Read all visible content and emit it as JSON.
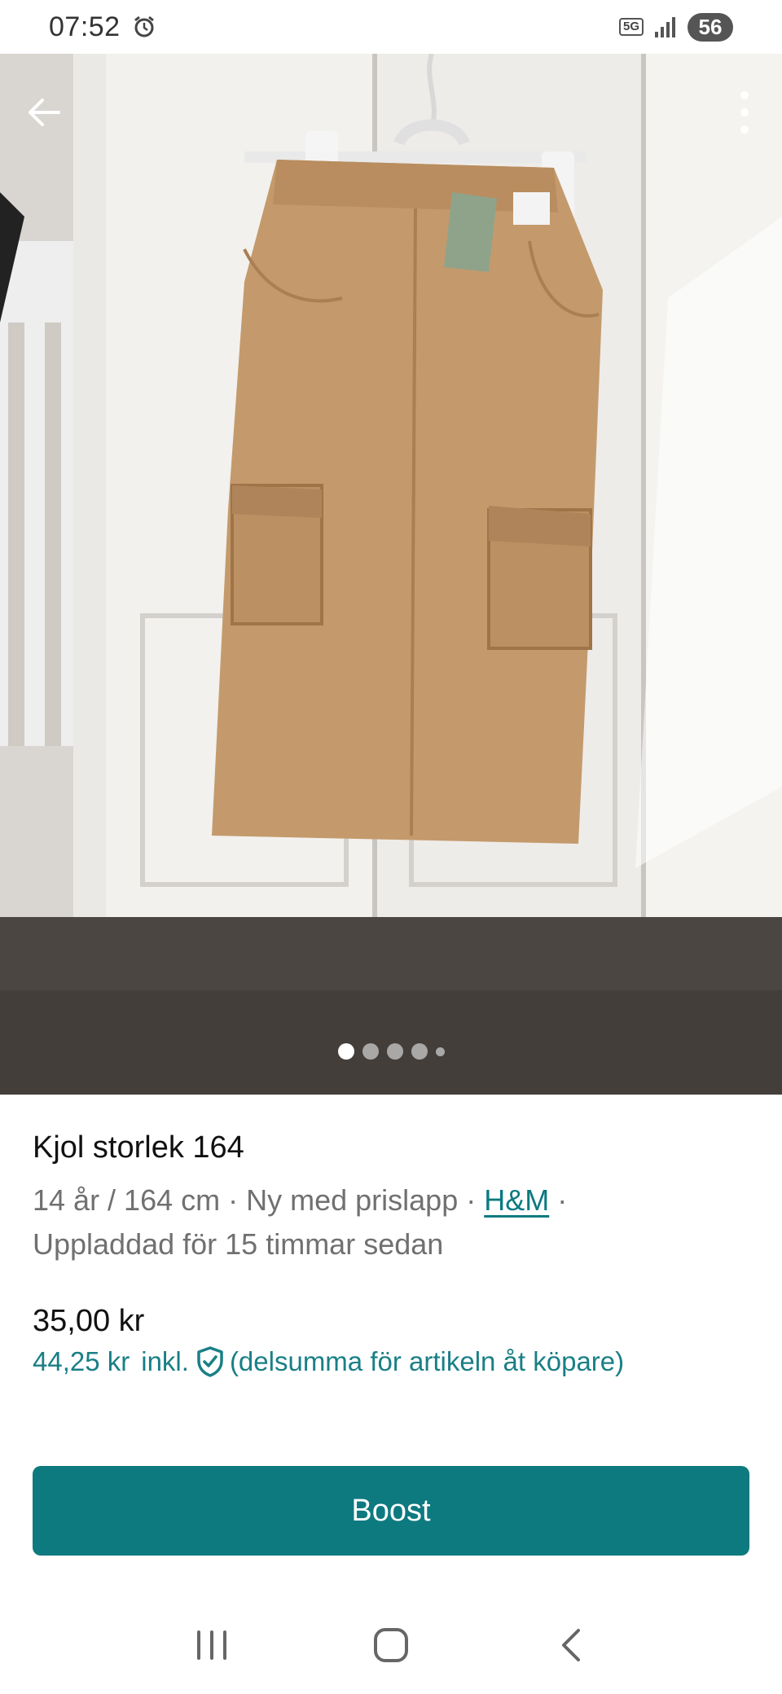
{
  "status_bar": {
    "time": "07:52",
    "network": "5G",
    "battery": "56",
    "icons": [
      "alarm-icon",
      "signal-icon"
    ]
  },
  "photo": {
    "pages": 5,
    "active_page": 1,
    "icons": [
      "back-arrow-icon",
      "more-vertical-icon"
    ]
  },
  "item": {
    "title": "Kjol storlek 164",
    "size": "14 år / 164 cm",
    "separator": " · ",
    "condition": "Ny med prislapp",
    "brand": "H&M",
    "uploaded": "Uppladdad för 15 timmar sedan",
    "price": "35,00 kr",
    "price_incl": "44,25 kr",
    "incl_label": "inkl.",
    "incl_note": "(delsumma för artikeln åt köpare)"
  },
  "actions": {
    "boost_label": "Boost"
  },
  "nav_bar": {
    "icons": [
      "recent-apps-icon",
      "home-icon",
      "back-icon"
    ]
  },
  "colors": {
    "accent": "#0d7a80",
    "link": "#1a7f86",
    "text_muted": "#707070"
  }
}
